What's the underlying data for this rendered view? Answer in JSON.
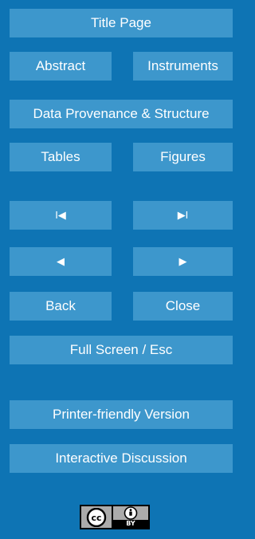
{
  "nav": {
    "title_page": "Title Page",
    "abstract": "Abstract",
    "instruments": "Instruments",
    "data_provenance": "Data Provenance & Structure",
    "tables": "Tables",
    "figures": "Figures",
    "first": "I◀",
    "last": "▶I",
    "prev": "◀",
    "next": "▶",
    "back": "Back",
    "close": "Close",
    "full_screen": "Full Screen / Esc",
    "printer_friendly": "Printer-friendly Version",
    "interactive_discussion": "Interactive Discussion"
  },
  "license": {
    "cc_text": "cc",
    "by_text": "BY",
    "icon": "creative-commons-by-icon"
  },
  "colors": {
    "background": "#0e74b4",
    "button": "#3d97cc",
    "text": "#ffffff"
  }
}
